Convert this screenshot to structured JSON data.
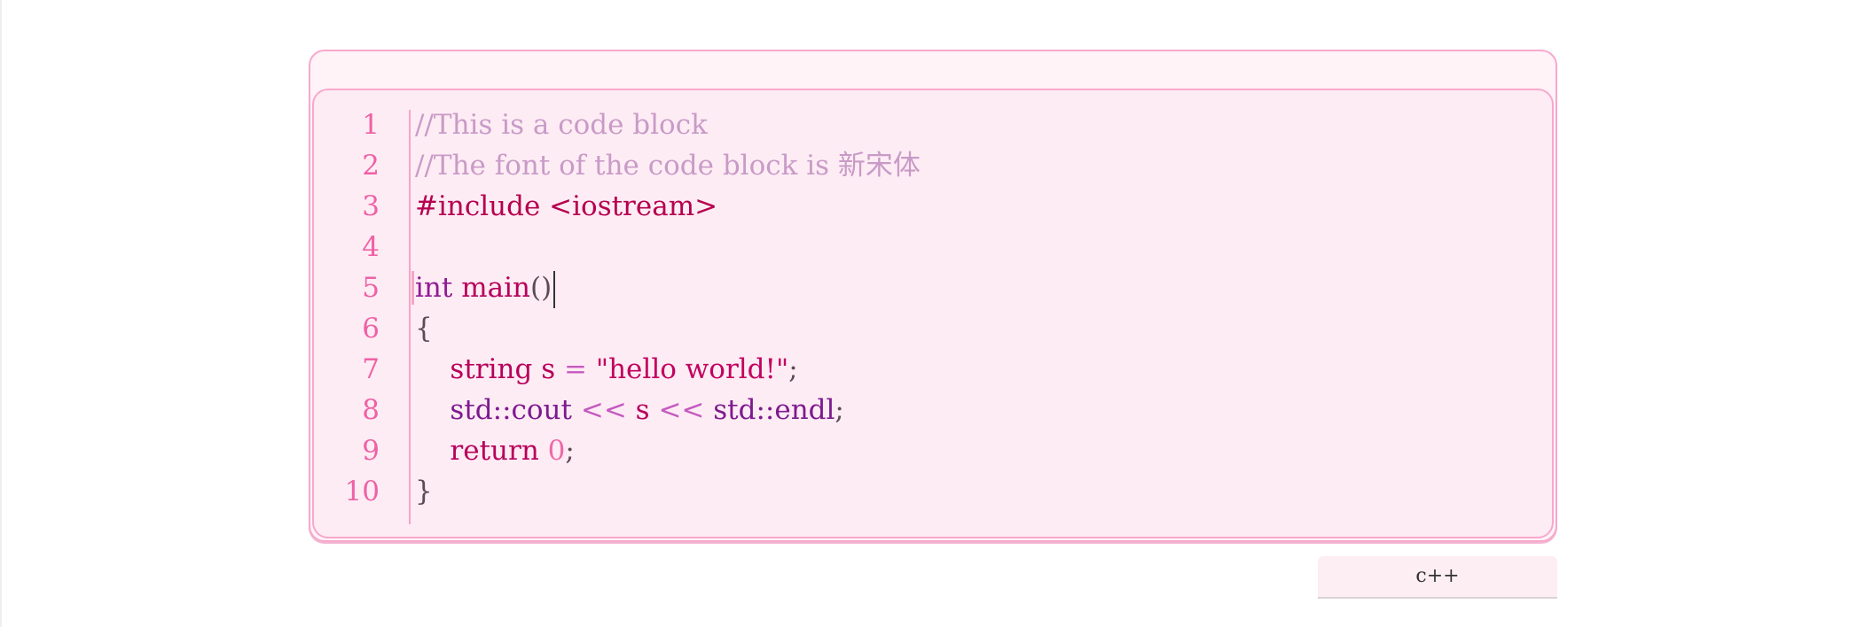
{
  "code_block": {
    "language": "c++",
    "line_numbers": [
      "1",
      "2",
      "3",
      "4",
      "5",
      "6",
      "7",
      "8",
      "9",
      "10"
    ],
    "lines": [
      [
        {
          "t": "comment",
          "v": "//This is a code block"
        }
      ],
      [
        {
          "t": "comment",
          "v": "//The font of the code block is 新宋体"
        }
      ],
      [
        {
          "t": "pre",
          "v": "#include <iostream>"
        }
      ],
      [],
      [
        {
          "t": "kw",
          "v": "int"
        },
        {
          "t": "punc",
          "v": " "
        },
        {
          "t": "id",
          "v": "main"
        },
        {
          "t": "punc",
          "v": "()"
        }
      ],
      [
        {
          "t": "punc",
          "v": "{"
        }
      ],
      [
        {
          "t": "punc",
          "v": "    "
        },
        {
          "t": "id",
          "v": "string"
        },
        {
          "t": "punc",
          "v": " "
        },
        {
          "t": "id",
          "v": "s"
        },
        {
          "t": "punc",
          "v": " "
        },
        {
          "t": "op",
          "v": "="
        },
        {
          "t": "punc",
          "v": " "
        },
        {
          "t": "str",
          "v": "\"hello world!\""
        },
        {
          "t": "punc",
          "v": ";"
        }
      ],
      [
        {
          "t": "punc",
          "v": "    "
        },
        {
          "t": "fn",
          "v": "std::cout"
        },
        {
          "t": "punc",
          "v": " "
        },
        {
          "t": "op",
          "v": "<<"
        },
        {
          "t": "punc",
          "v": " "
        },
        {
          "t": "id",
          "v": "s"
        },
        {
          "t": "punc",
          "v": " "
        },
        {
          "t": "op",
          "v": "<<"
        },
        {
          "t": "punc",
          "v": " "
        },
        {
          "t": "fn",
          "v": "std::endl"
        },
        {
          "t": "punc",
          "v": ";"
        }
      ],
      [
        {
          "t": "punc",
          "v": "    "
        },
        {
          "t": "id",
          "v": "return"
        },
        {
          "t": "punc",
          "v": " "
        },
        {
          "t": "num",
          "v": "0"
        },
        {
          "t": "punc",
          "v": ";"
        }
      ],
      [
        {
          "t": "punc",
          "v": "}"
        }
      ]
    ],
    "active_line": 5
  },
  "colors": {
    "border": "#f7a8cc",
    "panel_bg": "#feecf4",
    "line_number": "#ef61a5",
    "comment": "#c89bc7"
  },
  "icons": []
}
